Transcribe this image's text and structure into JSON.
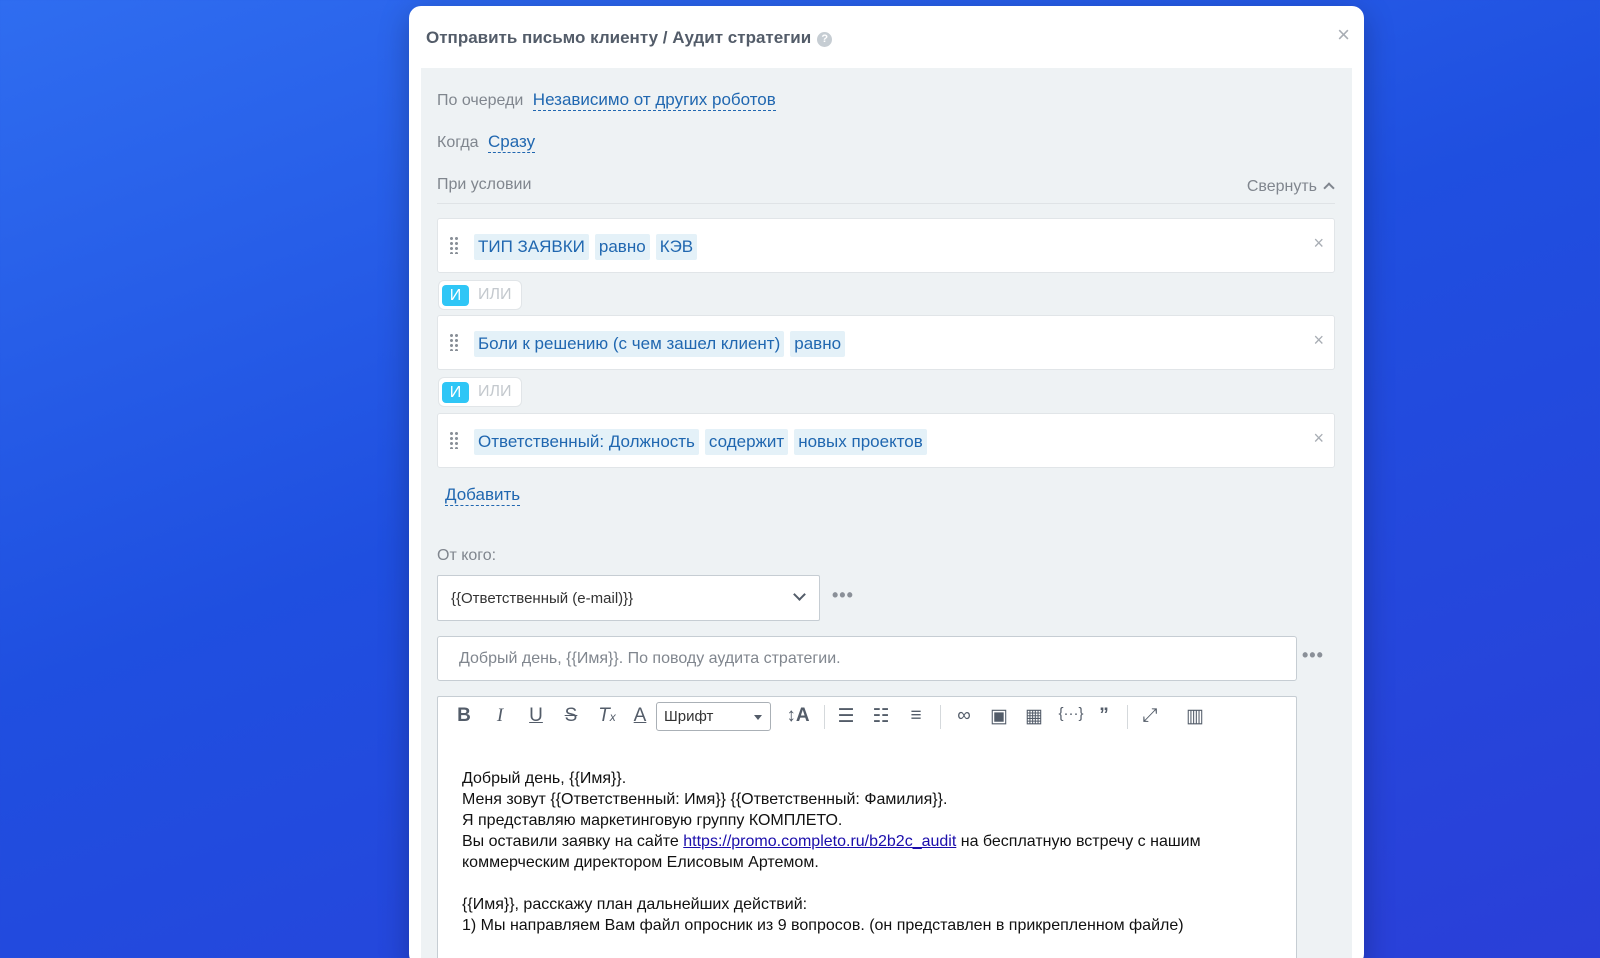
{
  "dialog": {
    "title": "Отправить письмо клиенту / Аудит стратегии",
    "help": "?",
    "close": "×"
  },
  "queue": {
    "label": "По очереди",
    "value": "Независимо от других роботов"
  },
  "when": {
    "label": "Когда",
    "value": "Сразу"
  },
  "conditions": {
    "label": "При условии",
    "collapse": "Свернуть",
    "items": [
      {
        "field": "ТИП ЗАЯВКИ",
        "op": "равно",
        "value": "КЭВ"
      },
      {
        "field": "Боли к решению (с чем зашел клиент)",
        "op": "равно",
        "value": ""
      },
      {
        "field": "Ответственный: Должность",
        "op": "содержит",
        "value": "новых проектов"
      }
    ],
    "and_label": "И",
    "or_label": "ИЛИ",
    "remove": "×",
    "add": "Добавить"
  },
  "from": {
    "label": "От кого:",
    "value": "{{Ответственный (e-mail)}}"
  },
  "more": "•••",
  "subject": "Добрый день, {{Имя}}. По поводу аудита стратегии.",
  "toolbar": {
    "font_label": "Шрифт"
  },
  "email_body": {
    "line1": "Добрый день, {{Имя}}.",
    "line2": "Меня зовут {{Ответственный: Имя}} {{Ответственный: Фамилия}}.",
    "line3": "Я представляю маркетинговую группу КОМПЛЕТО.",
    "line4_pre": "Вы оставили заявку на сайте ",
    "line4_link": "https://promo.completo.ru/b2b2c_audit",
    "line4_post": " на бесплатную встречу с нашим коммерческим директором Елисовым Артемом.",
    "line5": "{{Имя}}, расскажу план дальнейших действий:",
    "line6": "1) Мы направляем Вам файл опросник из 9 вопросов. (он представлен в прикрепленном файле)"
  }
}
